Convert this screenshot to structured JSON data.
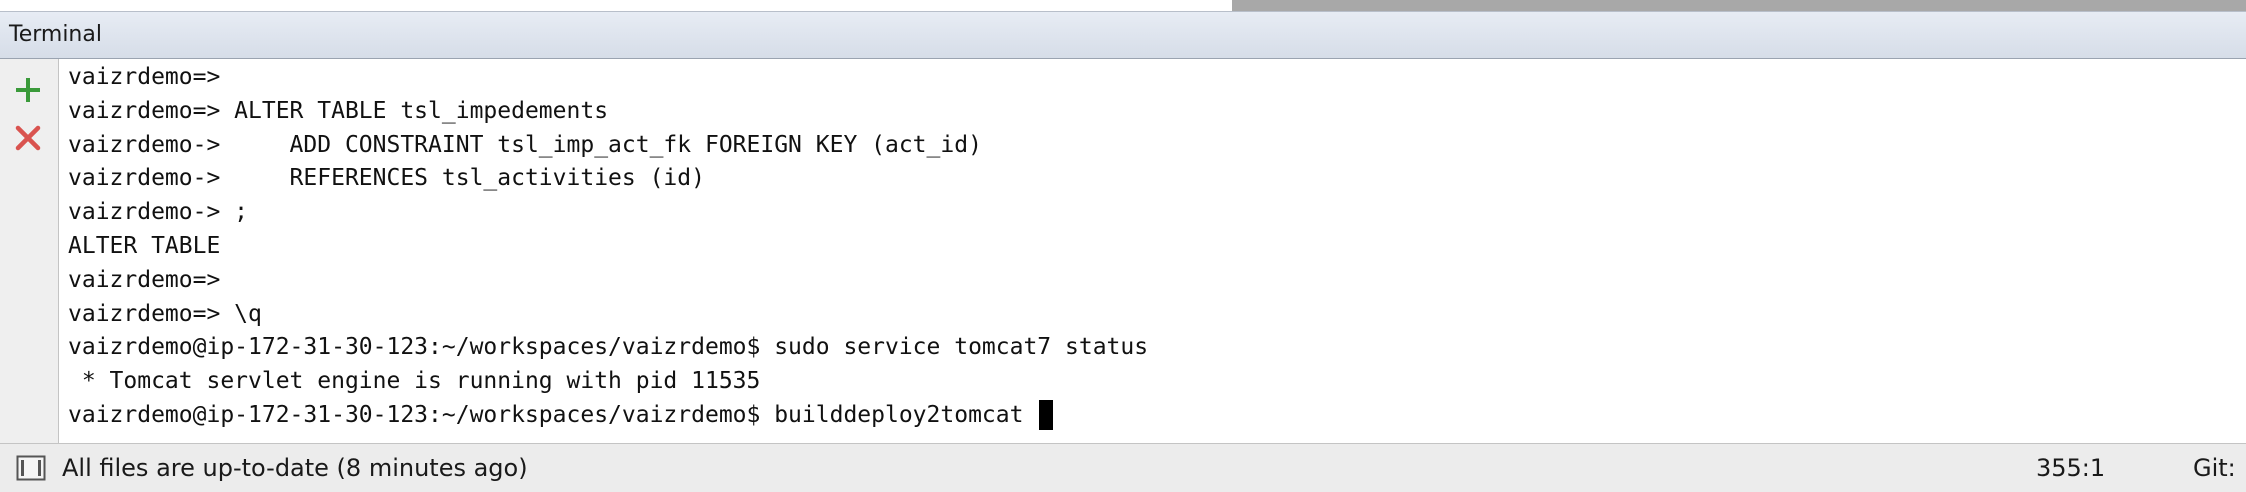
{
  "panel": {
    "title": "Terminal"
  },
  "toolbar": {
    "new_session_icon": "plus-icon",
    "close_session_icon": "close-icon",
    "colors": {
      "add": "#3a9a3a",
      "close": "#d9534f"
    }
  },
  "terminal": {
    "lines": [
      "vaizrdemo=>",
      "vaizrdemo=> ALTER TABLE tsl_impedements",
      "vaizrdemo->     ADD CONSTRAINT tsl_imp_act_fk FOREIGN KEY (act_id)",
      "vaizrdemo->     REFERENCES tsl_activities (id)",
      "vaizrdemo-> ;",
      "ALTER TABLE",
      "vaizrdemo=>",
      "vaizrdemo=> \\q",
      "vaizrdemo@ip-172-31-30-123:~/workspaces/vaizrdemo$ sudo service tomcat7 status",
      " * Tomcat servlet engine is running with pid 11535",
      "vaizrdemo@ip-172-31-30-123:~/workspaces/vaizrdemo$ builddeploy2tomcat "
    ]
  },
  "status_bar": {
    "message": "All files are up-to-date (8 minutes ago)",
    "position": "355:1",
    "vcs": "Git:"
  }
}
